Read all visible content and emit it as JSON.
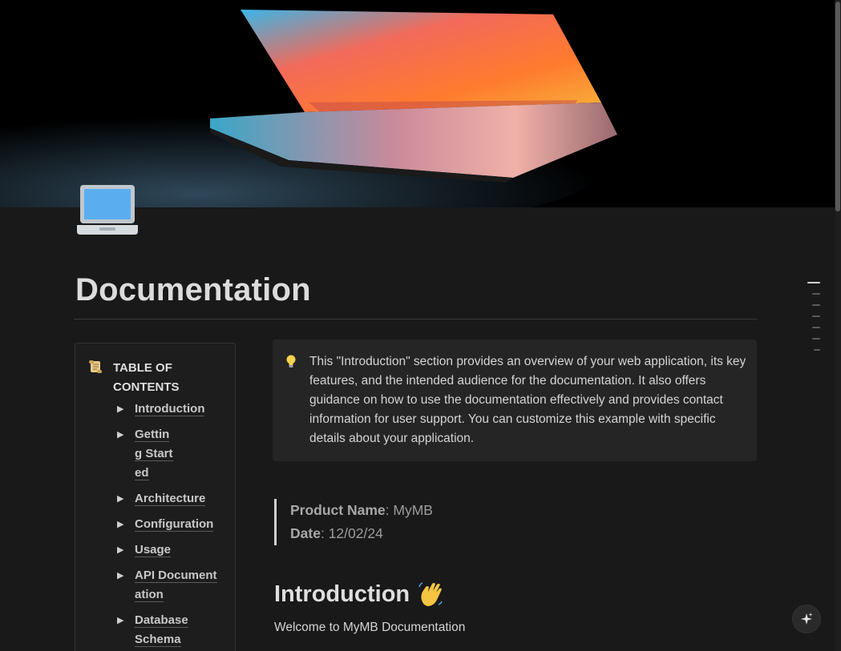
{
  "page": {
    "title": "Documentation",
    "icon": "laptop-emoji-icon",
    "cover": "laptop-dark-photo"
  },
  "toc": {
    "icon": "scroll-icon",
    "title": "TABLE OF CONTENTS",
    "items": [
      {
        "label": "Introduction"
      },
      {
        "label": "Getting Started"
      },
      {
        "label": "Architecture"
      },
      {
        "label": "Configuration"
      },
      {
        "label": "Usage"
      },
      {
        "label": "API Documentation"
      },
      {
        "label": "Database Schema"
      }
    ]
  },
  "callout": {
    "icon": "lightbulb-icon",
    "text": "This \"Introduction\" section provides an overview of your web application, its key features, and the intended audience for the documentation. It also offers guidance on how to use the documentation effectively and provides contact information for user support. You can customize this example with specific details about your application."
  },
  "quote": {
    "product_label": "Product Name",
    "product_value": ": MyMB",
    "date_label": "Date",
    "date_value": ": 12/02/24"
  },
  "intro": {
    "heading": "Introduction",
    "emoji": "waving-hand-icon",
    "text": "Welcome to MyMB Documentation"
  },
  "ai_button": {
    "icon": "sparkle-icon"
  },
  "colors": {
    "background": "#191919",
    "callout_bg": "#252525",
    "text": "#d4d4d4"
  }
}
